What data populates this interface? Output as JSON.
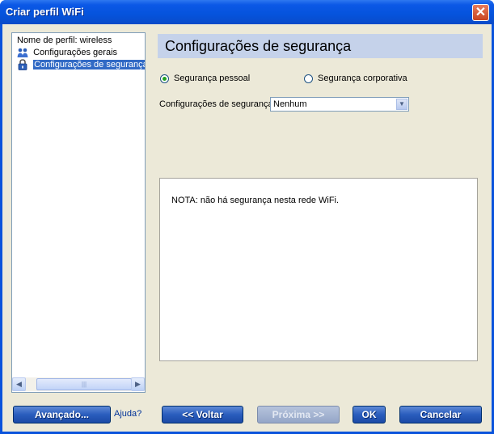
{
  "window": {
    "title": "Criar perfil WiFi",
    "close_glyph": "✕"
  },
  "tree": {
    "items": [
      {
        "label": "Nome de perfil: wireless",
        "icon": "none"
      },
      {
        "label": "Configurações gerais",
        "icon": "users-icon"
      },
      {
        "label": "Configurações de segurança",
        "icon": "lock-icon",
        "selected": true
      }
    ],
    "scroll_left_glyph": "◀",
    "scroll_right_glyph": "▶",
    "scroll_thumb_grip": "|||"
  },
  "main": {
    "header_title": "Configurações de segurança",
    "radio_personal": {
      "label": "Segurança pessoal",
      "checked": true
    },
    "radio_corporate": {
      "label": "Segurança corporativa",
      "checked": false
    },
    "security_select": {
      "label": "Configurações de segurança",
      "value": "Nenhum",
      "arrow_glyph": "▼"
    },
    "note": "NOTA: não há segurança nesta rede WiFi."
  },
  "buttons": {
    "advanced": "Avançado...",
    "help": "Ajuda?",
    "back": "<< Voltar",
    "next": "Próxima >>",
    "ok": "OK",
    "cancel": "Cancelar"
  },
  "colors": {
    "title_bar": "#0553dc",
    "header_bg": "#c5d2ea",
    "selection": "#316ac5",
    "dialog_bg": "#ece9d8"
  }
}
